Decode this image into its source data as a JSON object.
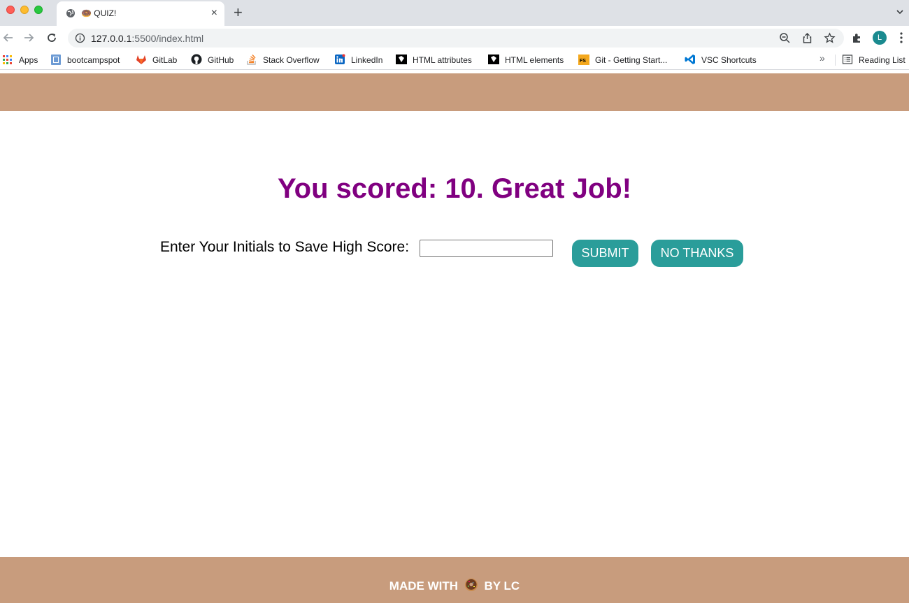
{
  "browser": {
    "tab_title": "🍩 QUIZ!",
    "tab_close_glyph": "×",
    "new_tab_glyph": "+",
    "url_host": "127.0.0.1",
    "url_rest": ":5500/index.html",
    "profile_initial": "L",
    "bookmarks": [
      {
        "label": "Apps",
        "icon": "apps-grid-icon"
      },
      {
        "label": "bootcampspot",
        "icon": "bootcampspot-icon"
      },
      {
        "label": "GitLab",
        "icon": "gitlab-icon"
      },
      {
        "label": "GitHub",
        "icon": "github-icon"
      },
      {
        "label": "Stack Overflow",
        "icon": "stackoverflow-icon"
      },
      {
        "label": "LinkedIn",
        "icon": "linkedin-icon"
      },
      {
        "label": "HTML attributes",
        "icon": "html-attributes-icon"
      },
      {
        "label": "HTML elements",
        "icon": "html-elements-icon"
      },
      {
        "label": "Git - Getting Start...",
        "icon": "git-docs-icon"
      },
      {
        "label": "VSC Shortcuts",
        "icon": "vscode-icon"
      }
    ],
    "bookmarks_more_glyph": "»",
    "reading_list_label": "Reading List"
  },
  "page": {
    "score_message": "You scored: 10. Great Job!",
    "initials_label": "Enter Your Initials to Save High Score:",
    "initials_value": "",
    "submit_label": "SUBMIT",
    "no_thanks_label": "NO THANKS",
    "footer_before": "MADE WITH",
    "footer_after": "BY LC"
  },
  "colors": {
    "header_footer_bg": "#c89c7d",
    "score_text": "#800080",
    "button_bg": "#2a9d9a",
    "button_text": "#ffffff",
    "footer_text": "#ffffff"
  }
}
